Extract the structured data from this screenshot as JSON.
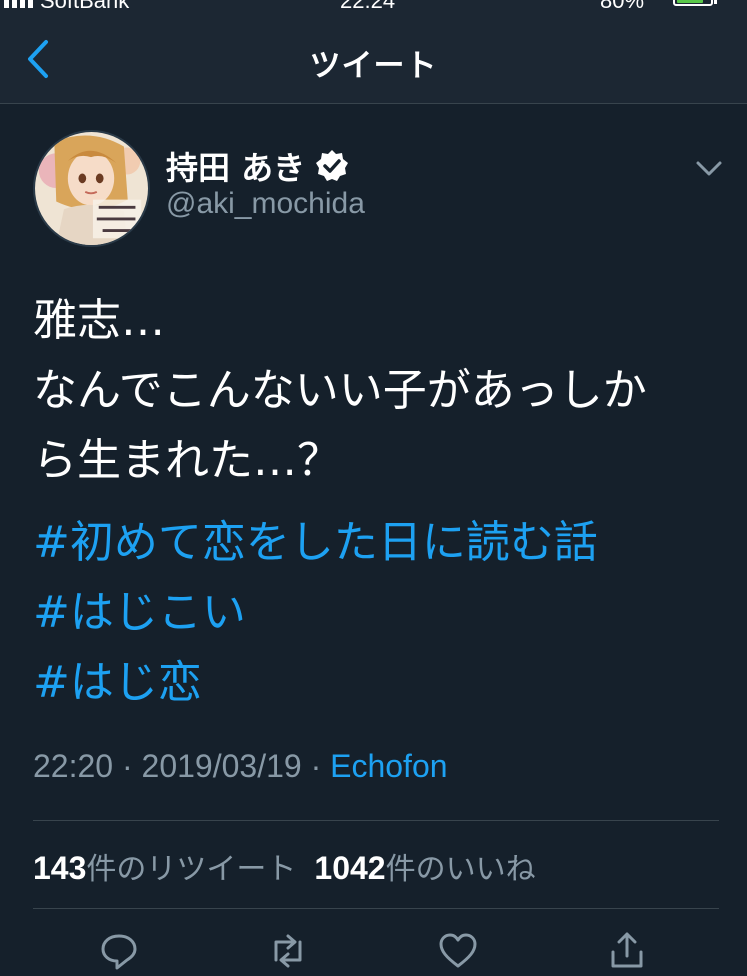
{
  "status_bar": {
    "carrier": "SoftBank",
    "time": "22:24",
    "battery": "80%",
    "battery_level": 0.8
  },
  "nav": {
    "title": "ツイート",
    "back_icon": "chevron-left-icon"
  },
  "author": {
    "display_name": "持田 あき",
    "handle": "@aki_mochida",
    "verified_icon": "verified-badge-icon",
    "menu_icon": "chevron-down-icon"
  },
  "tweet": {
    "lines": [
      "雅志…",
      "なんでこんないい子があっしか",
      "ら生まれた…？"
    ],
    "hashtags": [
      "#初めて恋をした日に読む話",
      "#はじこい",
      "#はじ恋"
    ],
    "time": "22:20",
    "date": "2019/03/19",
    "separator": "·",
    "via": "Echofon"
  },
  "stats": {
    "retweets_count": "143",
    "retweets_label": "件のリツイート",
    "likes_count": "1042",
    "likes_label": "件のいいね"
  },
  "actions": [
    "reply-icon",
    "retweet-icon",
    "like-icon",
    "share-icon"
  ],
  "colors": {
    "background": "#15202b",
    "accent": "#1da1f2",
    "secondary_text": "#8899a6"
  }
}
